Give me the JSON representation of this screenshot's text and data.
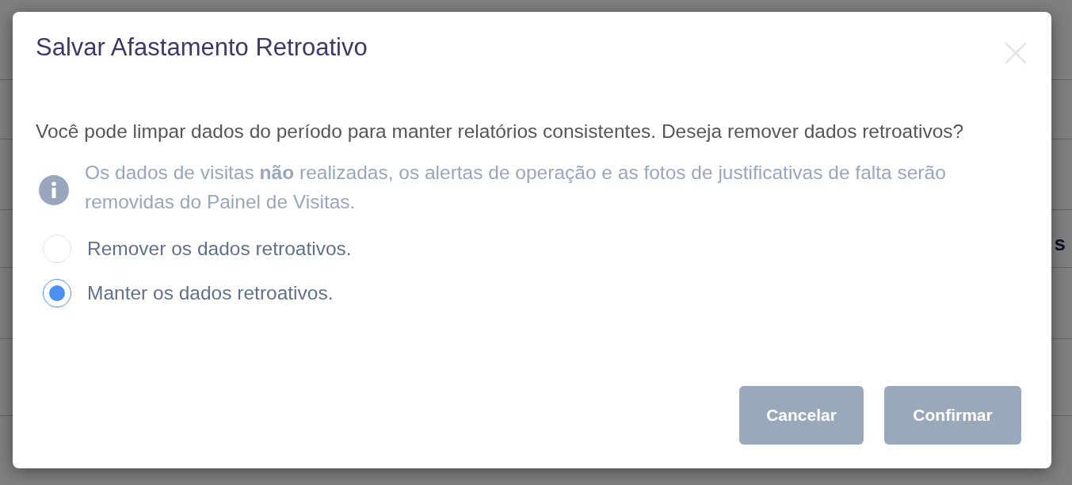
{
  "background_page": {
    "rows": [
      {
        "text": ""
      },
      {
        "text": ""
      },
      {
        "text": "s"
      },
      {
        "text": ""
      },
      {
        "text": ""
      }
    ]
  },
  "dialog": {
    "title": "Salvar Afastamento Retroativo",
    "message": "Você pode limpar dados do período para manter relatórios consistentes. Deseja remover dados retroativos?",
    "info": "Os dados de visitas **não** realizadas, os alertas de operação e as fotos de justificativas de falta serão removidas do Painel de Visitas.",
    "options": [
      {
        "label": "Remover os dados retroativos.",
        "selected": false
      },
      {
        "label": "Manter os dados retroativos.",
        "selected": true
      }
    ],
    "buttons": [
      {
        "label": "Cancelar"
      },
      {
        "label": "Confirmar"
      }
    ]
  }
}
